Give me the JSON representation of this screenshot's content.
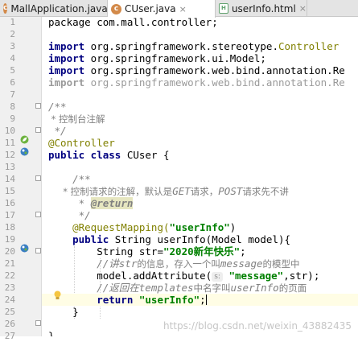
{
  "tabs": [
    {
      "label": "MallApplication.java",
      "type": "java",
      "active": false
    },
    {
      "label": "CUser.java",
      "type": "java",
      "active": true
    },
    {
      "label": "userInfo.html",
      "type": "html",
      "active": false
    }
  ],
  "line_numbers": [
    "1",
    "2",
    "3",
    "4",
    "5",
    "6",
    "7",
    "8",
    "9",
    "10",
    "11",
    "12",
    "13",
    "14",
    "15",
    "16",
    "17",
    "18",
    "19",
    "20",
    "21",
    "22",
    "23",
    "24",
    "25",
    "26",
    "27"
  ],
  "code": {
    "l1": "package com.mall.controller;",
    "l3_kw": "import",
    "l3_a": " org.springframework.stereotype.",
    "l3_b": "Controller",
    "l4_kw": "import",
    "l4_a": " org.springframework.ui.Model;",
    "l5_kw": "import",
    "l5_a": " org.springframework.web.bind.annotation.Re",
    "l6_kw": "import",
    "l6_a": " org.springframework.web.bind.annotation.Re",
    "l8": "/**",
    "l9": " * 控制台注解",
    "l10": " */",
    "l11": "@Controller",
    "l12_kw": "public class",
    "l12_a": " CUser {",
    "l14": "    /**",
    "l15_a": "     * 控制请求的注解，默认是",
    "l15_b": "GET",
    "l15_c": "请求，",
    "l15_d": "POST",
    "l15_e": "请求先不讲",
    "l16_a": "     * ",
    "l16_b": "@return",
    "l17": "     */",
    "l18_a": "    @RequestMapping(",
    "l18_b": "\"userInfo\"",
    "l18_c": ")",
    "l19_kw": "    public",
    "l19_a": " String userInfo(Model model){",
    "l20_a": "        String str=",
    "l20_b": "\"2020新年快乐\"",
    "l20_c": ";",
    "l21_a": "        //讲",
    "l21_b": "str",
    "l21_c": "的信息，存入一个叫",
    "l21_d": "message",
    "l21_e": "的模型中",
    "l22_a": "        model.addAttribute(",
    "l22_hint": "s:",
    "l22_b": " \"message\"",
    "l22_c": ",str);",
    "l23_a": "        //返回在",
    "l23_b": "templates",
    "l23_c": "中名字叫",
    "l23_d": "userInfo",
    "l23_e": "的页面",
    "l24_kw": "        return",
    "l24_b": " \"userInfo\"",
    "l24_c": ";",
    "l25": "    }",
    "l27": "}"
  },
  "watermark": "https://blog.csdn.net/weixin_43882435"
}
